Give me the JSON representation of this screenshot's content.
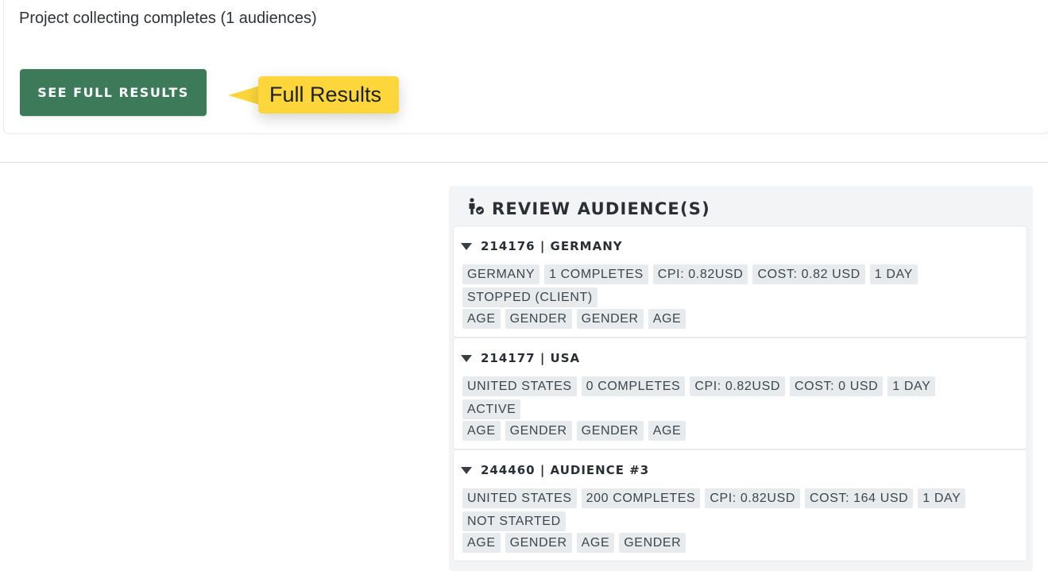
{
  "project": {
    "status_text": "Project collecting completes (1 audiences)",
    "see_full_results_label": "SEE FULL RESULTS",
    "tooltip_label": "Full Results"
  },
  "review": {
    "title": "REVIEW AUDIENCE(S)",
    "icon": "audience-check-icon",
    "audiences": [
      {
        "title": "214176 | GERMANY",
        "tags": [
          "GERMANY",
          "1 COMPLETES",
          "CPI: 0.82USD",
          "COST: 0.82 USD",
          "1 DAY"
        ],
        "status": "STOPPED (CLIENT)",
        "targets": [
          "AGE",
          "GENDER",
          "GENDER",
          "AGE"
        ]
      },
      {
        "title": "214177 | USA",
        "tags": [
          "UNITED STATES",
          "0 COMPLETES",
          "CPI: 0.82USD",
          "COST: 0 USD",
          "1 DAY"
        ],
        "status": "ACTIVE",
        "targets": [
          "AGE",
          "GENDER",
          "GENDER",
          "AGE"
        ]
      },
      {
        "title": "244460 | AUDIENCE #3",
        "tags": [
          "UNITED STATES",
          "200 COMPLETES",
          "CPI: 0.82USD",
          "COST: 164 USD",
          "1 DAY"
        ],
        "status": "NOT STARTED",
        "targets": [
          "AGE",
          "GENDER",
          "AGE",
          "GENDER"
        ]
      }
    ]
  },
  "colors": {
    "button_green": "#3d7a5a",
    "tooltip_yellow": "#fcd63a",
    "tag_bg": "#e7ebed",
    "panel_bg": "#f3f4f5"
  }
}
